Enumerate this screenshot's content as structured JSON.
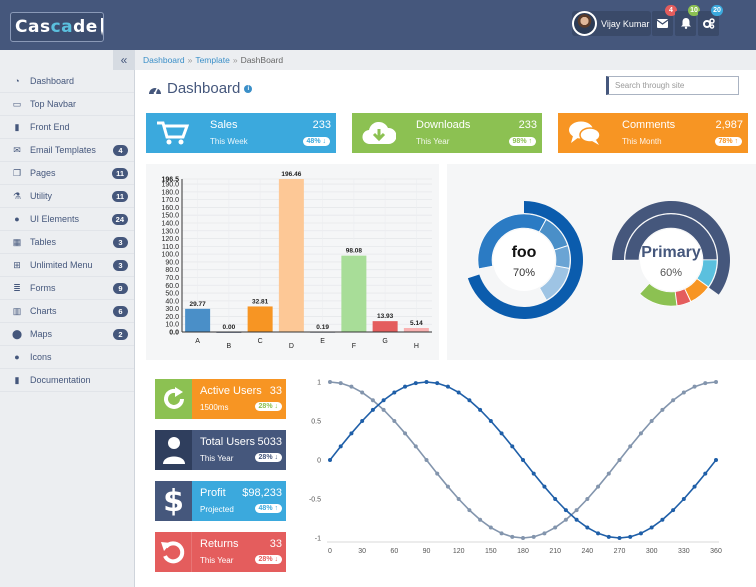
{
  "brand": {
    "logo_prefix": "Cas",
    "logo_accent": "ca",
    "logo_suffix": "de"
  },
  "header": {
    "user_name": "Vijay Kumar",
    "messages_count": "4",
    "notifications_count": "10",
    "settings_count": "20",
    "colors": {
      "messages_badge": "#e45d5d",
      "notifications_badge": "#8cc152",
      "settings_badge": "#3ba9dd"
    }
  },
  "sidebar": {
    "items": [
      {
        "label": "Dashboard",
        "icon": "dashboard-icon",
        "badge": ""
      },
      {
        "label": "Top Navbar",
        "icon": "laptop-icon",
        "badge": ""
      },
      {
        "label": "Front End",
        "icon": "file-icon",
        "badge": ""
      },
      {
        "label": "Email Templates",
        "icon": "envelope-icon",
        "badge": "4"
      },
      {
        "label": "Pages",
        "icon": "copy-icon",
        "badge": "11"
      },
      {
        "label": "Utility",
        "icon": "flask-icon",
        "badge": "11"
      },
      {
        "label": "UI Elements",
        "icon": "tint-icon",
        "badge": "24"
      },
      {
        "label": "Tables",
        "icon": "table-icon",
        "badge": "3"
      },
      {
        "label": "Unlimited Menu",
        "icon": "sitemap-icon",
        "badge": "3"
      },
      {
        "label": "Forms",
        "icon": "list-icon",
        "badge": "9"
      },
      {
        "label": "Charts",
        "icon": "chart-icon",
        "badge": "6"
      },
      {
        "label": "Maps",
        "icon": "map-marker-icon",
        "badge": "2"
      },
      {
        "label": "Icons",
        "icon": "tint-icon",
        "badge": ""
      },
      {
        "label": "Documentation",
        "icon": "file-icon",
        "badge": ""
      }
    ]
  },
  "breadcrumb": {
    "items": [
      "Dashboard",
      "Template"
    ],
    "current": "DashBoard",
    "separator": "»"
  },
  "page": {
    "title": "Dashboard"
  },
  "search": {
    "placeholder": "Search through site"
  },
  "stats": [
    {
      "label": "Sales",
      "sub": "This Week",
      "value": "233",
      "pill": "48%",
      "trend": "down",
      "color": "#3ba9dd"
    },
    {
      "label": "Downloads",
      "sub": "This Year",
      "value": "233",
      "pill": "98%",
      "trend": "up",
      "color": "#8cc152"
    },
    {
      "label": "Comments",
      "sub": "This Month",
      "value": "2,987",
      "pill": "78%",
      "trend": "up",
      "color": "#f79523"
    }
  ],
  "tiles": [
    {
      "label": "Active Users",
      "sub": "1500ms",
      "value": "33",
      "pill": "28%",
      "trend": "down",
      "icon": "refresh-icon",
      "tile_color": "#f79523",
      "icon_color": "#8cc152"
    },
    {
      "label": "Total Users",
      "sub": "This Year",
      "value": "5033",
      "pill": "28%",
      "trend": "down",
      "icon": "user-icon",
      "tile_color": "#45577c",
      "icon_color": "#2f3e5d"
    },
    {
      "label": "Profit",
      "sub": "Projected",
      "value": "$98,233",
      "pill": "48%",
      "trend": "up",
      "icon": "dollar-icon",
      "tile_color": "#3ba9dd",
      "icon_color": "#45577c"
    },
    {
      "label": "Returns",
      "sub": "This Year",
      "value": "33",
      "pill": "28%",
      "trend": "down",
      "icon": "undo-icon",
      "tile_color": "#e45d5d",
      "icon_color": "#e45d5d"
    }
  ],
  "chart_data": [
    {
      "type": "bar",
      "categories": [
        "A",
        "B",
        "C",
        "D",
        "E",
        "F",
        "G",
        "H"
      ],
      "values": [
        29.77,
        0.0,
        32.81,
        196.46,
        0.19,
        98.08,
        13.93,
        5.14
      ],
      "value_labels": [
        "29.77",
        "0.00",
        "32.81",
        "196.46",
        "0.19",
        "98.08",
        "13.93",
        "5.14"
      ],
      "colors": [
        "#4a8fc8",
        "#45577c",
        "#f79523",
        "#fdc896",
        "#45577c",
        "#a8dd98",
        "#e45d5d",
        "#f9b1b1"
      ],
      "yticks": [
        "0.0",
        "10.0",
        "20.0",
        "30.0",
        "40.0",
        "50.0",
        "60.0",
        "70.0",
        "80.0",
        "90.0",
        "100.0",
        "110.0",
        "120.0",
        "130.0",
        "140.0",
        "150.0",
        "160.0",
        "170.0",
        "180.0",
        "190.0",
        "196.5"
      ],
      "ylim": [
        0,
        196.5
      ],
      "grid": true
    },
    {
      "type": "pie",
      "center_label": "foo",
      "center_value": "70%",
      "outer": [
        0.7,
        0.3
      ],
      "inner": [
        0.36,
        0.12,
        0.08,
        0.14,
        0.3
      ],
      "outer_colors": [
        "#0b5cad",
        "#ffffff"
      ],
      "inner_colors": [
        "#2b7bc4",
        "#4a8fc8",
        "#6aa4d4",
        "#9ec4e4",
        "#ffffff"
      ]
    },
    {
      "type": "pie",
      "center_label": "Primary",
      "center_value": "60%",
      "outer": [
        0.6,
        0.4
      ],
      "inner": [
        0.5,
        0.1,
        0.08,
        0.05,
        0.14,
        0.13
      ],
      "outer_colors": [
        "#45577c",
        "#ffffff"
      ],
      "inner_colors": [
        "#45577c",
        "#5bc0de",
        "#f79523",
        "#e45d5d",
        "#8cc152",
        "#ffffff"
      ]
    },
    {
      "type": "line",
      "x": [
        0,
        10,
        20,
        30,
        40,
        50,
        60,
        70,
        80,
        90,
        100,
        110,
        120,
        130,
        140,
        150,
        160,
        170,
        180,
        190,
        200,
        210,
        220,
        230,
        240,
        250,
        260,
        270,
        280,
        290,
        300,
        310,
        320,
        330,
        340,
        350,
        360
      ],
      "series": [
        {
          "values": [
            0,
            0.174,
            0.342,
            0.5,
            0.643,
            0.766,
            0.866,
            0.94,
            0.985,
            1,
            0.985,
            0.94,
            0.866,
            0.766,
            0.643,
            0.5,
            0.342,
            0.174,
            0,
            -0.174,
            -0.342,
            -0.5,
            -0.643,
            -0.766,
            -0.866,
            -0.94,
            -0.985,
            -1,
            -0.985,
            -0.94,
            -0.866,
            -0.766,
            -0.643,
            -0.5,
            -0.342,
            -0.174,
            0
          ],
          "color": "#1f5fa8"
        },
        {
          "values": [
            1,
            0.985,
            0.94,
            0.866,
            0.766,
            0.643,
            0.5,
            0.342,
            0.174,
            0,
            -0.174,
            -0.342,
            -0.5,
            -0.643,
            -0.766,
            -0.866,
            -0.94,
            -0.985,
            -1,
            -0.985,
            -0.94,
            -0.866,
            -0.766,
            -0.643,
            -0.5,
            -0.342,
            -0.174,
            0,
            0.174,
            0.342,
            0.5,
            0.643,
            0.766,
            0.866,
            0.94,
            0.985,
            1
          ],
          "color": "#8395ad"
        }
      ],
      "xticks": [
        "0",
        "30",
        "60",
        "90",
        "120",
        "150",
        "180",
        "210",
        "240",
        "270",
        "300",
        "330",
        "360"
      ],
      "yticks": [
        "1",
        "0.5",
        "0",
        "-0.5",
        "-1"
      ],
      "xlim": [
        0,
        360
      ],
      "ylim": [
        -1,
        1
      ]
    }
  ]
}
